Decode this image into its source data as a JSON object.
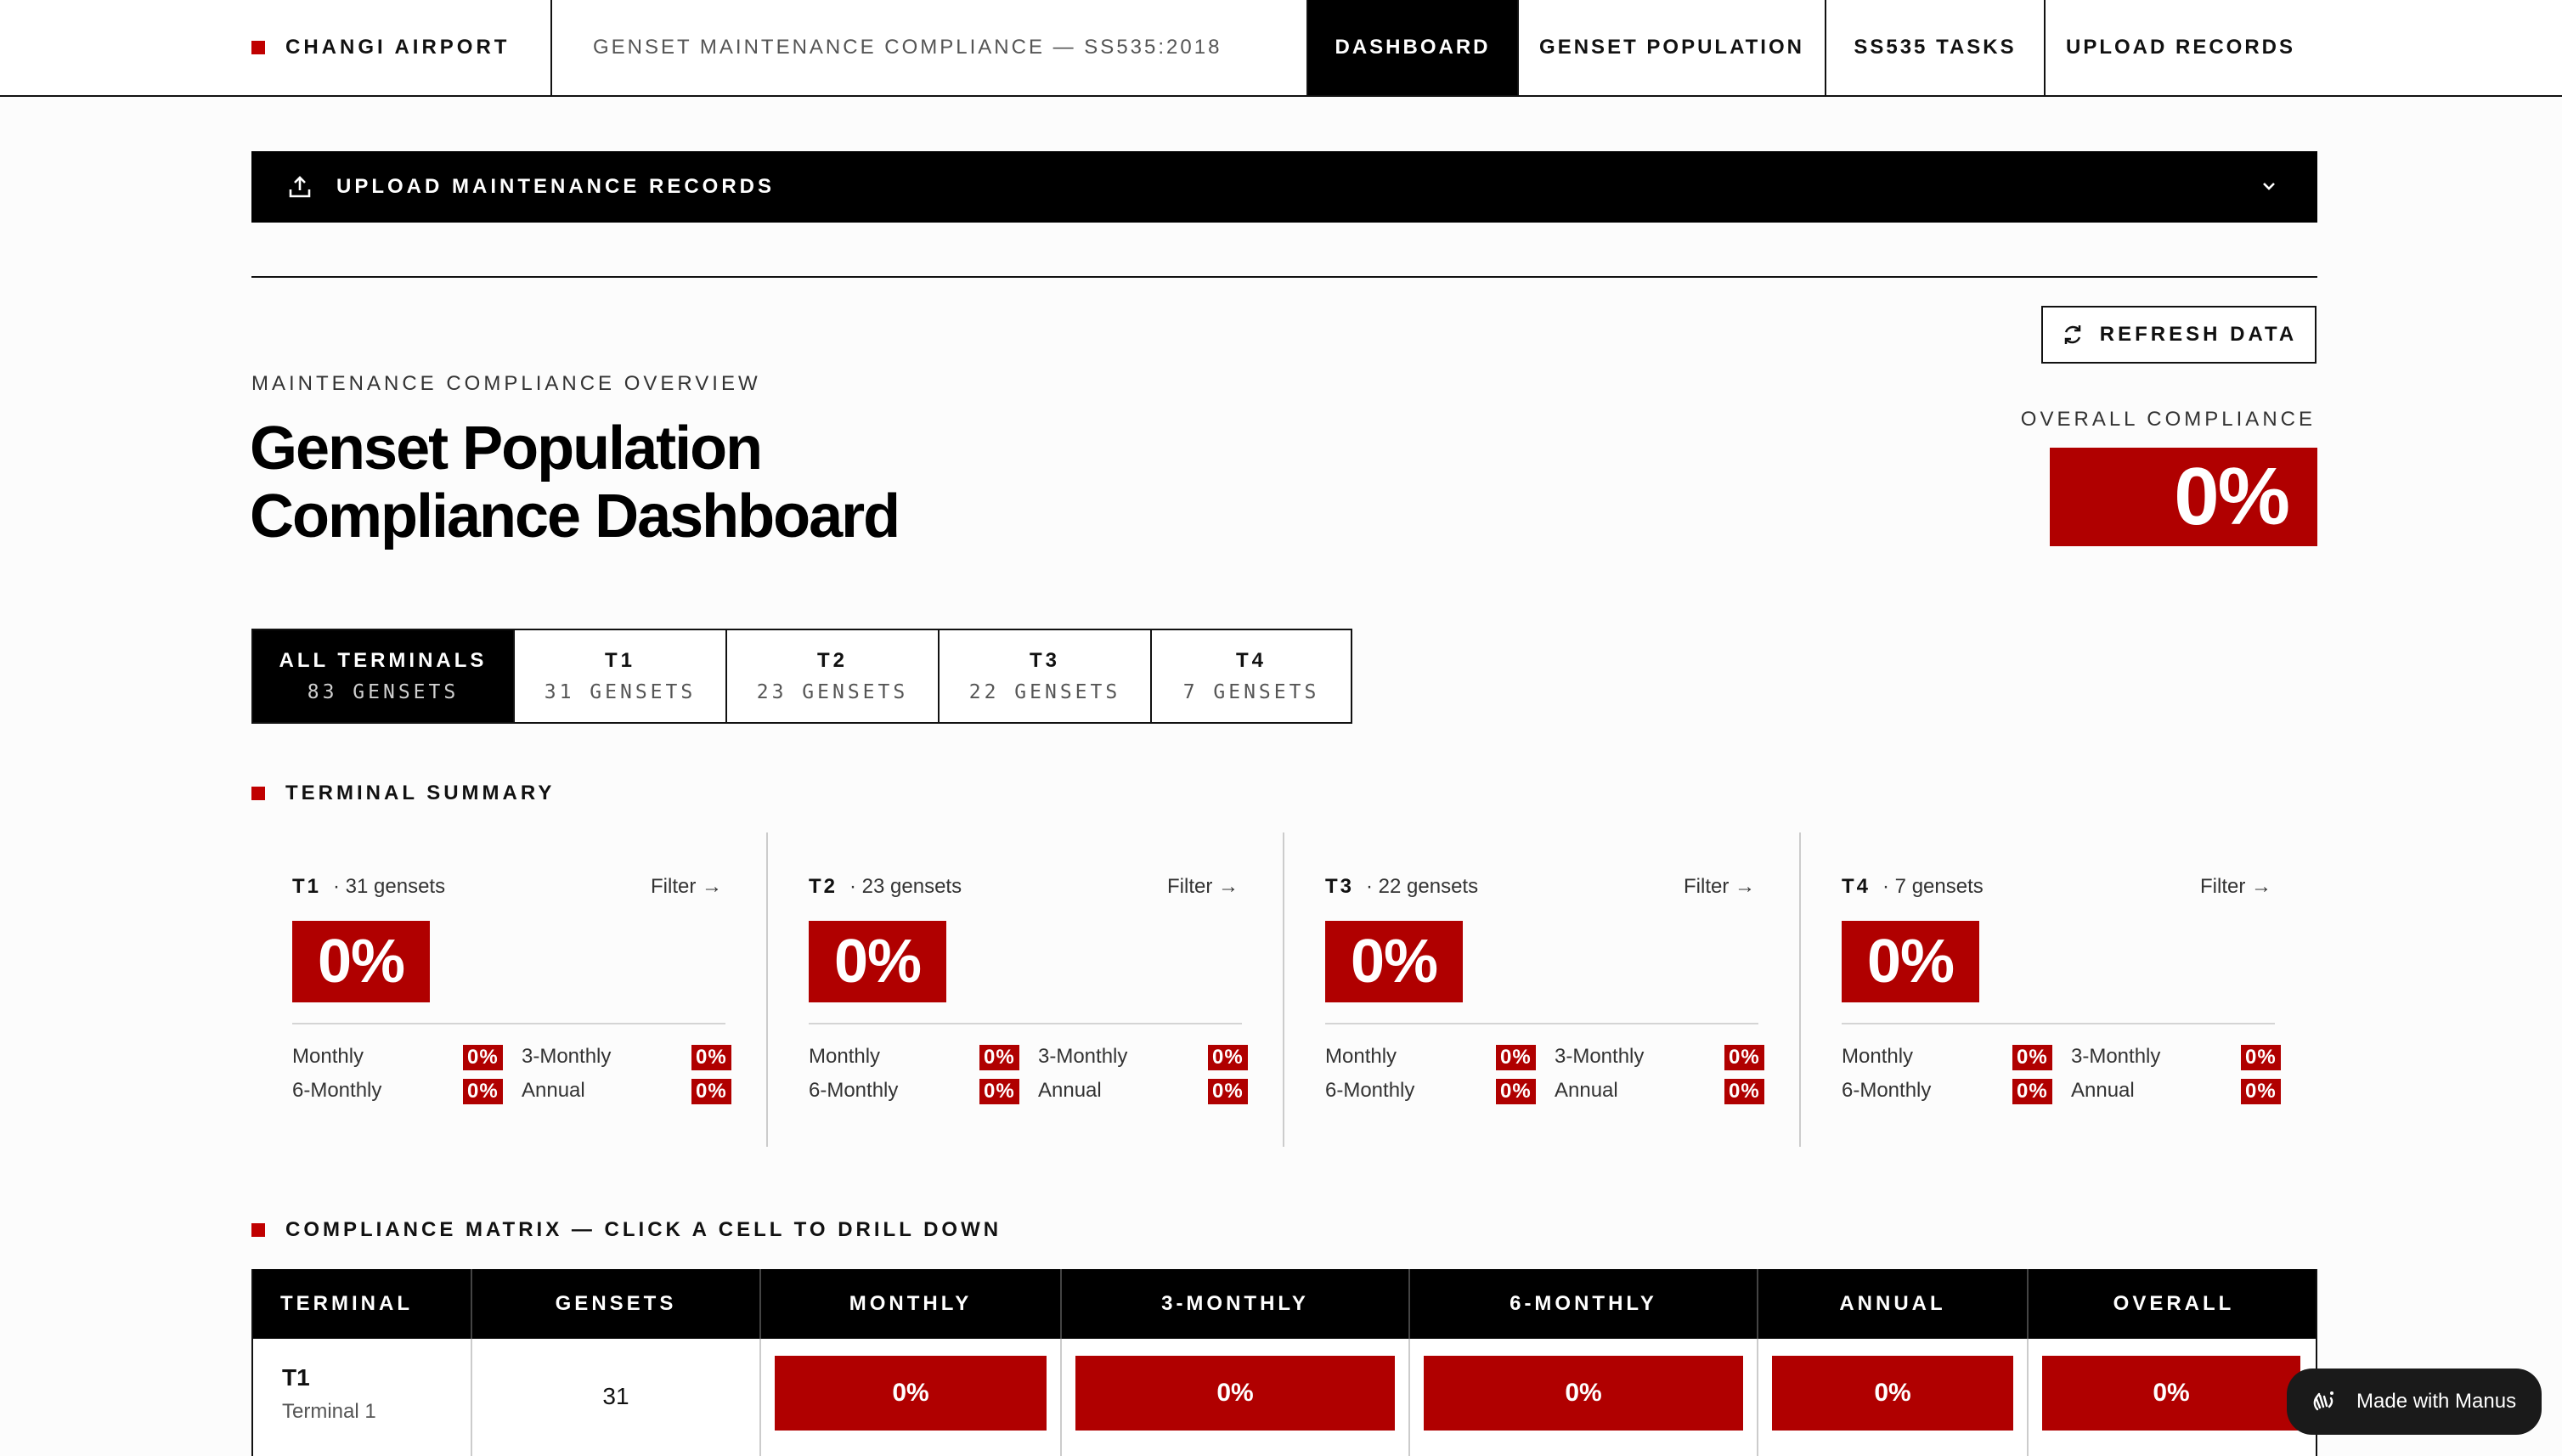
{
  "nav": {
    "brand": "CHANGI AIRPORT",
    "subtitle": "GENSET MAINTENANCE COMPLIANCE — SS535:2018",
    "tabs": [
      {
        "label": "DASHBOARD",
        "active": true
      },
      {
        "label": "GENSET POPULATION",
        "active": false
      },
      {
        "label": "SS535 TASKS",
        "active": false
      },
      {
        "label": "UPLOAD RECORDS",
        "active": false
      }
    ]
  },
  "upload_bar": {
    "label": "UPLOAD MAINTENANCE RECORDS",
    "icon": "upload-icon",
    "toggle_icon": "chevron-down-icon"
  },
  "refresh_button": {
    "label": "REFRESH DATA",
    "icon": "refresh-icon"
  },
  "header": {
    "overline": "MAINTENANCE COMPLIANCE OVERVIEW",
    "title_line1": "Genset Population",
    "title_line2": "Compliance Dashboard"
  },
  "overall": {
    "label": "OVERALL COMPLIANCE",
    "value": "0%"
  },
  "terminal_filters": [
    {
      "name": "ALL TERMINALS",
      "count": "83 GENSETS",
      "active": true
    },
    {
      "name": "T1",
      "count": "31 GENSETS",
      "active": false
    },
    {
      "name": "T2",
      "count": "23 GENSETS",
      "active": false
    },
    {
      "name": "T3",
      "count": "22 GENSETS",
      "active": false
    },
    {
      "name": "T4",
      "count": "7 GENSETS",
      "active": false
    }
  ],
  "terminal_summary": {
    "heading": "TERMINAL SUMMARY",
    "cards": [
      {
        "terminal": "T1",
        "count": "· 31 gensets",
        "filter": "Filter →",
        "overall": "0%",
        "rows": [
          {
            "a": "Monthly",
            "av": "0%",
            "b": "3-Monthly",
            "bv": "0%"
          },
          {
            "a": "6-Monthly",
            "av": "0%",
            "b": "Annual",
            "bv": "0%"
          }
        ]
      },
      {
        "terminal": "T2",
        "count": "· 23 gensets",
        "filter": "Filter →",
        "overall": "0%",
        "rows": [
          {
            "a": "Monthly",
            "av": "0%",
            "b": "3-Monthly",
            "bv": "0%"
          },
          {
            "a": "6-Monthly",
            "av": "0%",
            "b": "Annual",
            "bv": "0%"
          }
        ]
      },
      {
        "terminal": "T3",
        "count": "· 22 gensets",
        "filter": "Filter →",
        "overall": "0%",
        "rows": [
          {
            "a": "Monthly",
            "av": "0%",
            "b": "3-Monthly",
            "bv": "0%"
          },
          {
            "a": "6-Monthly",
            "av": "0%",
            "b": "Annual",
            "bv": "0%"
          }
        ]
      },
      {
        "terminal": "T4",
        "count": "· 7 gensets",
        "filter": "Filter →",
        "overall": "0%",
        "rows": [
          {
            "a": "Monthly",
            "av": "0%",
            "b": "3-Monthly",
            "bv": "0%"
          },
          {
            "a": "6-Monthly",
            "av": "0%",
            "b": "Annual",
            "bv": "0%"
          }
        ]
      }
    ]
  },
  "matrix": {
    "heading": "COMPLIANCE MATRIX — CLICK A CELL TO DRILL DOWN",
    "columns": [
      "TERMINAL",
      "GENSETS",
      "MONTHLY",
      "3-MONTHLY",
      "6-MONTHLY",
      "ANNUAL",
      "OVERALL"
    ],
    "rows": [
      {
        "terminal": "T1",
        "name": "Terminal 1",
        "gensets": "31",
        "monthly": "0%",
        "three_monthly": "0%",
        "six_monthly": "0%",
        "annual": "0%",
        "overall": "0%"
      }
    ]
  },
  "made_with": {
    "label": "Made with Manus",
    "icon": "manus-hand-icon"
  },
  "colors": {
    "accent_red": "#b00000",
    "bar_black": "#000000"
  }
}
